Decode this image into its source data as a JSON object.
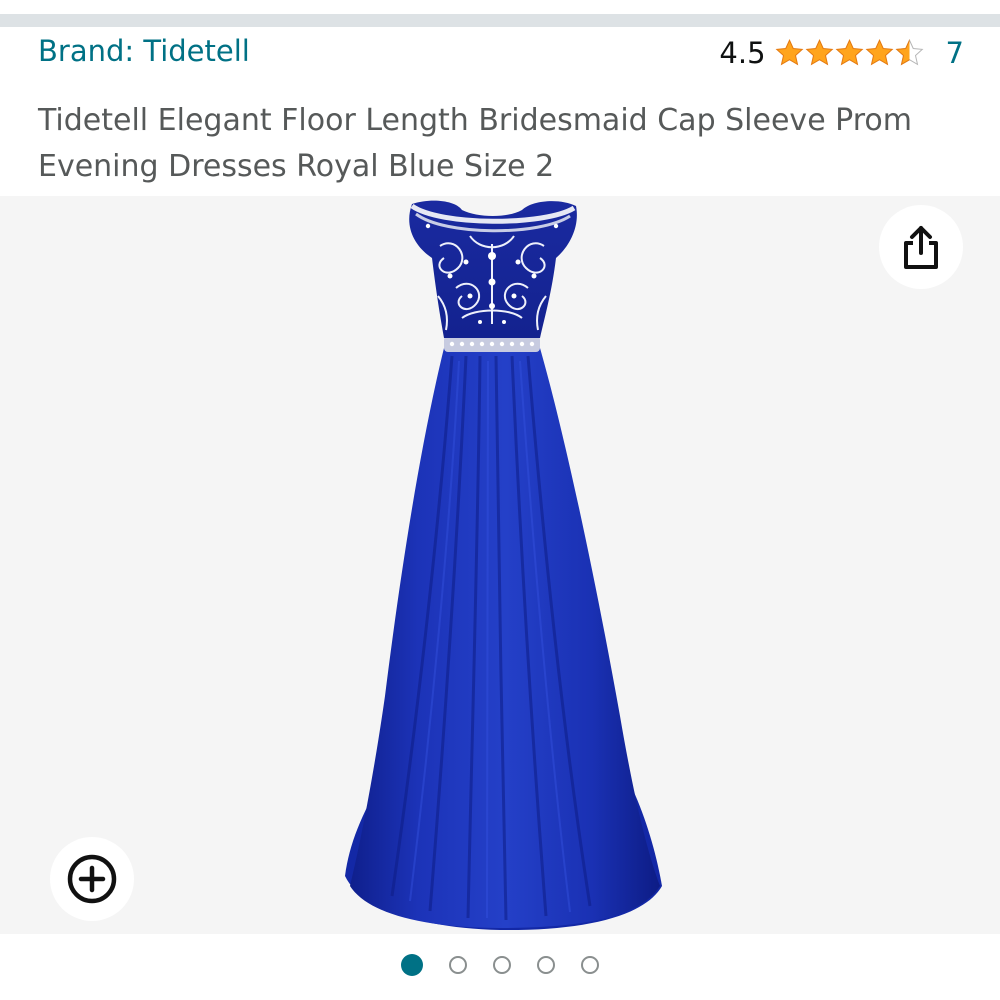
{
  "brand": {
    "label": "Brand: Tidetell"
  },
  "rating": {
    "value": "4.5",
    "stars_out_of_5": 4.5,
    "review_count": "7",
    "star_color": "#ffa41c"
  },
  "product": {
    "title": "Tidetell Elegant Floor Length Bridesmaid Cap Sleeve Prom Evening Dresses Royal Blue Size 2",
    "image_subject": "royal blue floor-length gown with beaded bodice and cap sleeves"
  },
  "image_actions": {
    "share_icon": "share-icon",
    "zoom_icon": "zoom-plus-icon"
  },
  "carousel": {
    "total_images": 5,
    "active_index": 1
  },
  "colors": {
    "link": "#007185",
    "title": "#565959",
    "dress_blue": "#1a2fb0"
  }
}
